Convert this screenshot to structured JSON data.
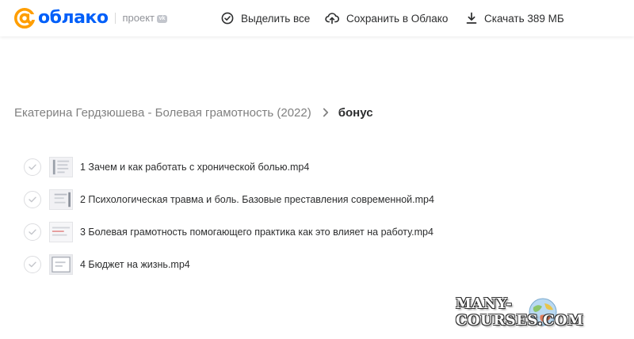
{
  "header": {
    "brand_name": "облако",
    "brand_suffix": "проект",
    "brand_badge": "vk",
    "actions": {
      "select_all": "Выделить все",
      "save_to_cloud": "Сохранить в Облако",
      "download": "Скачать 389 МБ"
    }
  },
  "breadcrumb": {
    "parent": "Екатерина Гердзюшева - Болевая грамотность (2022)",
    "current": "бонус"
  },
  "files": [
    {
      "name": "1 Зачем и как работать с хронической болью.mp4"
    },
    {
      "name": "2 Психологическая травма и боль. Базовые преставления современной.mp4"
    },
    {
      "name": "3 Болевая грамотность помогающего практика как это влияет на работу.mp4"
    },
    {
      "name": "4 Бюджет на жизнь.mp4"
    }
  ],
  "watermark": {
    "text": "MANY-COURSES.COM"
  },
  "colors": {
    "brand_blue": "#005ff9",
    "brand_orange": "#ff9e00",
    "text_muted": "#808080"
  },
  "icons": {
    "select_all": "check-circle-icon",
    "save_to_cloud": "cloud-upload-icon",
    "download": "download-icon",
    "breadcrumb_separator": "chevron-right-icon",
    "row_checkbox": "check-icon"
  }
}
